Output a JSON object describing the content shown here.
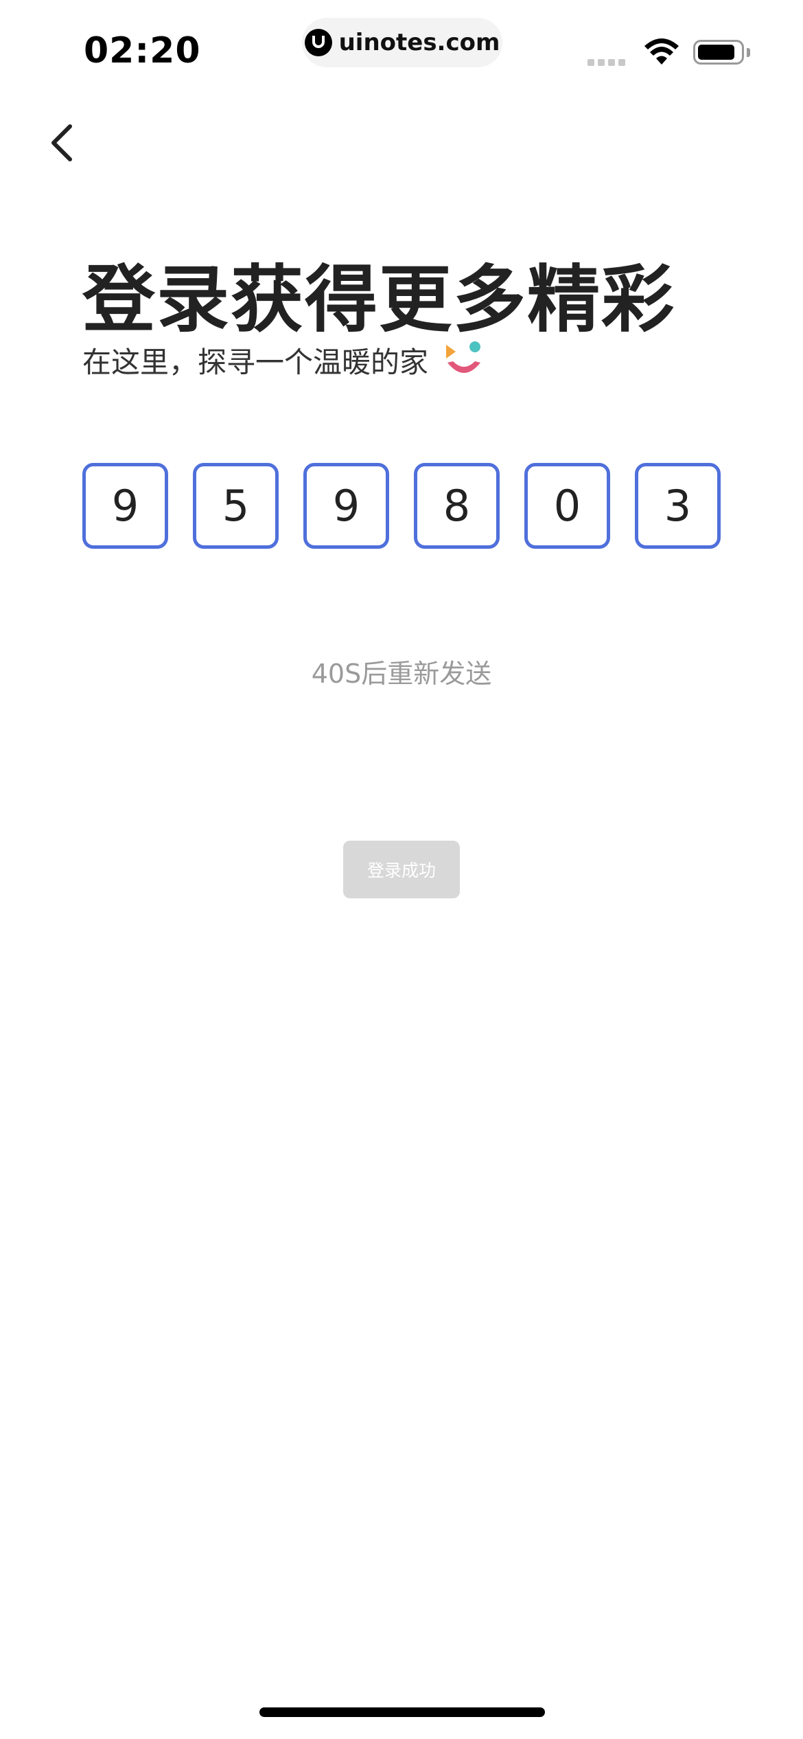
{
  "status_bar": {
    "time": "02:20",
    "url": "uinotes.com",
    "signal_icon": "signal-bars-icon",
    "wifi_icon": "wifi-icon",
    "battery_icon": "battery-icon",
    "battery_level": 0.88
  },
  "nav": {
    "back_icon": "chevron-left-icon"
  },
  "header": {
    "title": "登录获得更多精彩",
    "subtitle": "在这里，探寻一个温暖的家",
    "emoji_icon": "smiley-logo-icon",
    "colors": {
      "orange": "#F2A33A",
      "teal": "#4CC3C0",
      "pink": "#E2587A"
    }
  },
  "verification": {
    "digits": [
      "9",
      "5",
      "9",
      "8",
      "0",
      "3"
    ],
    "border_color": "#4F6FDB"
  },
  "resend": {
    "label": "40S后重新发送"
  },
  "login": {
    "label": "登录成功"
  }
}
